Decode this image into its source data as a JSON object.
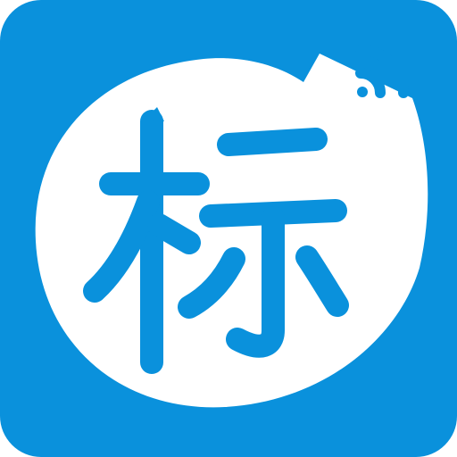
{
  "icon": {
    "glyph": "标",
    "depicts": [
      "speech-bubble",
      "signal-waves"
    ],
    "colors": {
      "background": "#0a91dc",
      "bubble": "#ffffff",
      "glyph": "#0a91dc",
      "signal": "#0a91dc"
    }
  }
}
